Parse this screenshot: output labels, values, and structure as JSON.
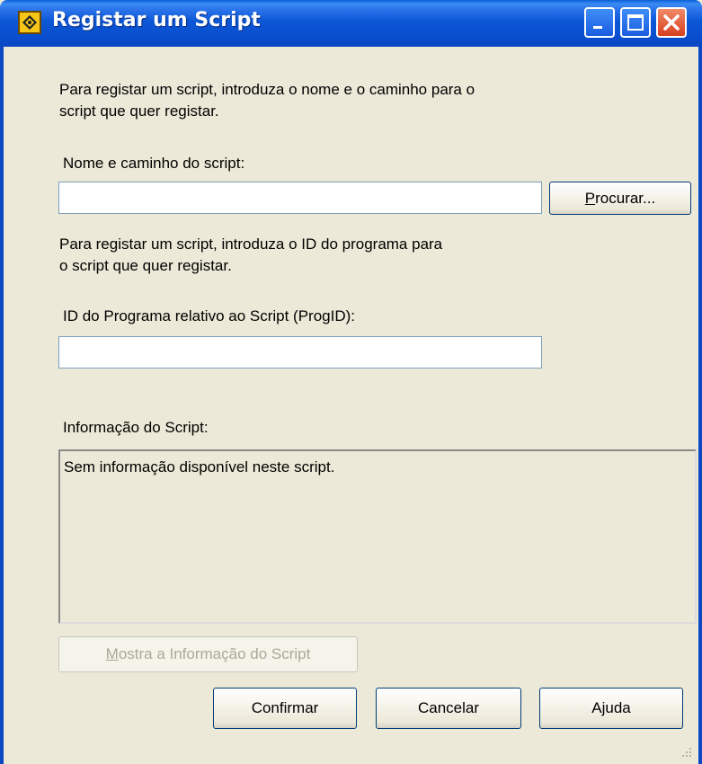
{
  "window": {
    "title": "Registar um Script"
  },
  "instructions": {
    "path_line1": "Para registar um script, introduza o nome e o caminho para o",
    "path_line2": "script que quer registar.",
    "progid_line1": "Para registar um script, introduza o ID do programa para",
    "progid_line2": "o script que quer registar."
  },
  "fields": {
    "path_label": "Nome e caminho do script:",
    "path_value": "",
    "progid_label": "ID do Programa relativo ao Script (ProgID):",
    "progid_value": ""
  },
  "info": {
    "label": "Informação do Script:",
    "text": "Sem informação disponível neste script."
  },
  "buttons": {
    "browse_mnemonic": "P",
    "browse_rest": "rocurar...",
    "show_info_mnemonic": "M",
    "show_info_rest": "ostra a Informação do Script",
    "confirm": "Confirmar",
    "cancel": "Cancelar",
    "help": "Ajuda"
  },
  "colors": {
    "titlebar": "#0a4fd0",
    "dialog_bg": "#ece9d8",
    "close_button": "#d8401e"
  },
  "icons": [
    "app-script-icon",
    "minimize-icon",
    "maximize-icon",
    "close-icon",
    "resize-grip-icon"
  ]
}
